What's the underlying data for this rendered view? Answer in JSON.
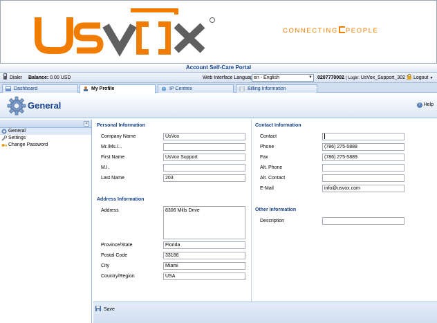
{
  "banner": {
    "logo_text": "UsVox",
    "tagline_part1": "CONNECTING",
    "tagline_part2": "PEOPLE"
  },
  "portal_title": "Account Self-Care Portal",
  "toolbar": {
    "dialer": "Dialer",
    "balance_label": "Balance:",
    "balance_value": "0.00 USD",
    "language_label": "Web Interface Language:",
    "language_value": "en - English",
    "account_number": "0207770002",
    "login_prefix": "( Login:",
    "login_value": "UsVox_Support_302 )",
    "logout": "Logout"
  },
  "tabs": [
    {
      "label": "Dashboard"
    },
    {
      "label": "My Profile"
    },
    {
      "label": "IP Centrex"
    },
    {
      "label": "Billing Information"
    }
  ],
  "header": {
    "title": "General",
    "help": "Help"
  },
  "leftnav": [
    {
      "label": "General"
    },
    {
      "label": "Settings"
    },
    {
      "label": "Change Password"
    }
  ],
  "personal": {
    "title": "Personal Information",
    "fields": [
      {
        "label": "Company Name",
        "value": "UsVox"
      },
      {
        "label": "Mr./Ms./...",
        "value": ""
      },
      {
        "label": "First Name",
        "value": "UsVox Support"
      },
      {
        "label": "M.I.",
        "value": ""
      },
      {
        "label": "Last Name",
        "value": "203"
      }
    ]
  },
  "address": {
    "title": "Address Information",
    "address_label": "Address",
    "address_value": "8306 Mills Drive",
    "fields": [
      {
        "label": "Province/State",
        "value": "Florida"
      },
      {
        "label": "Postal Code",
        "value": "33186"
      },
      {
        "label": "City",
        "value": "Miami"
      },
      {
        "label": "Country/Region",
        "value": "USA"
      }
    ]
  },
  "contact": {
    "title": "Contact Information",
    "fields": [
      {
        "label": "Contact",
        "value": ""
      },
      {
        "label": "Phone",
        "value": "(786) 275-5888"
      },
      {
        "label": "Fax",
        "value": "(786) 275-5889"
      },
      {
        "label": "Alt. Phone",
        "value": ""
      },
      {
        "label": "Alt. Contact",
        "value": ""
      },
      {
        "label": "E-Mail",
        "value": "info@usvox.com"
      }
    ]
  },
  "other": {
    "title": "Other Information",
    "description_label": "Description",
    "description_value": ""
  },
  "footer": {
    "save": "Save"
  },
  "colors": {
    "brand_orange": "#f07d00",
    "brand_gray": "#5f5f5f",
    "title_blue": "#15428b"
  }
}
